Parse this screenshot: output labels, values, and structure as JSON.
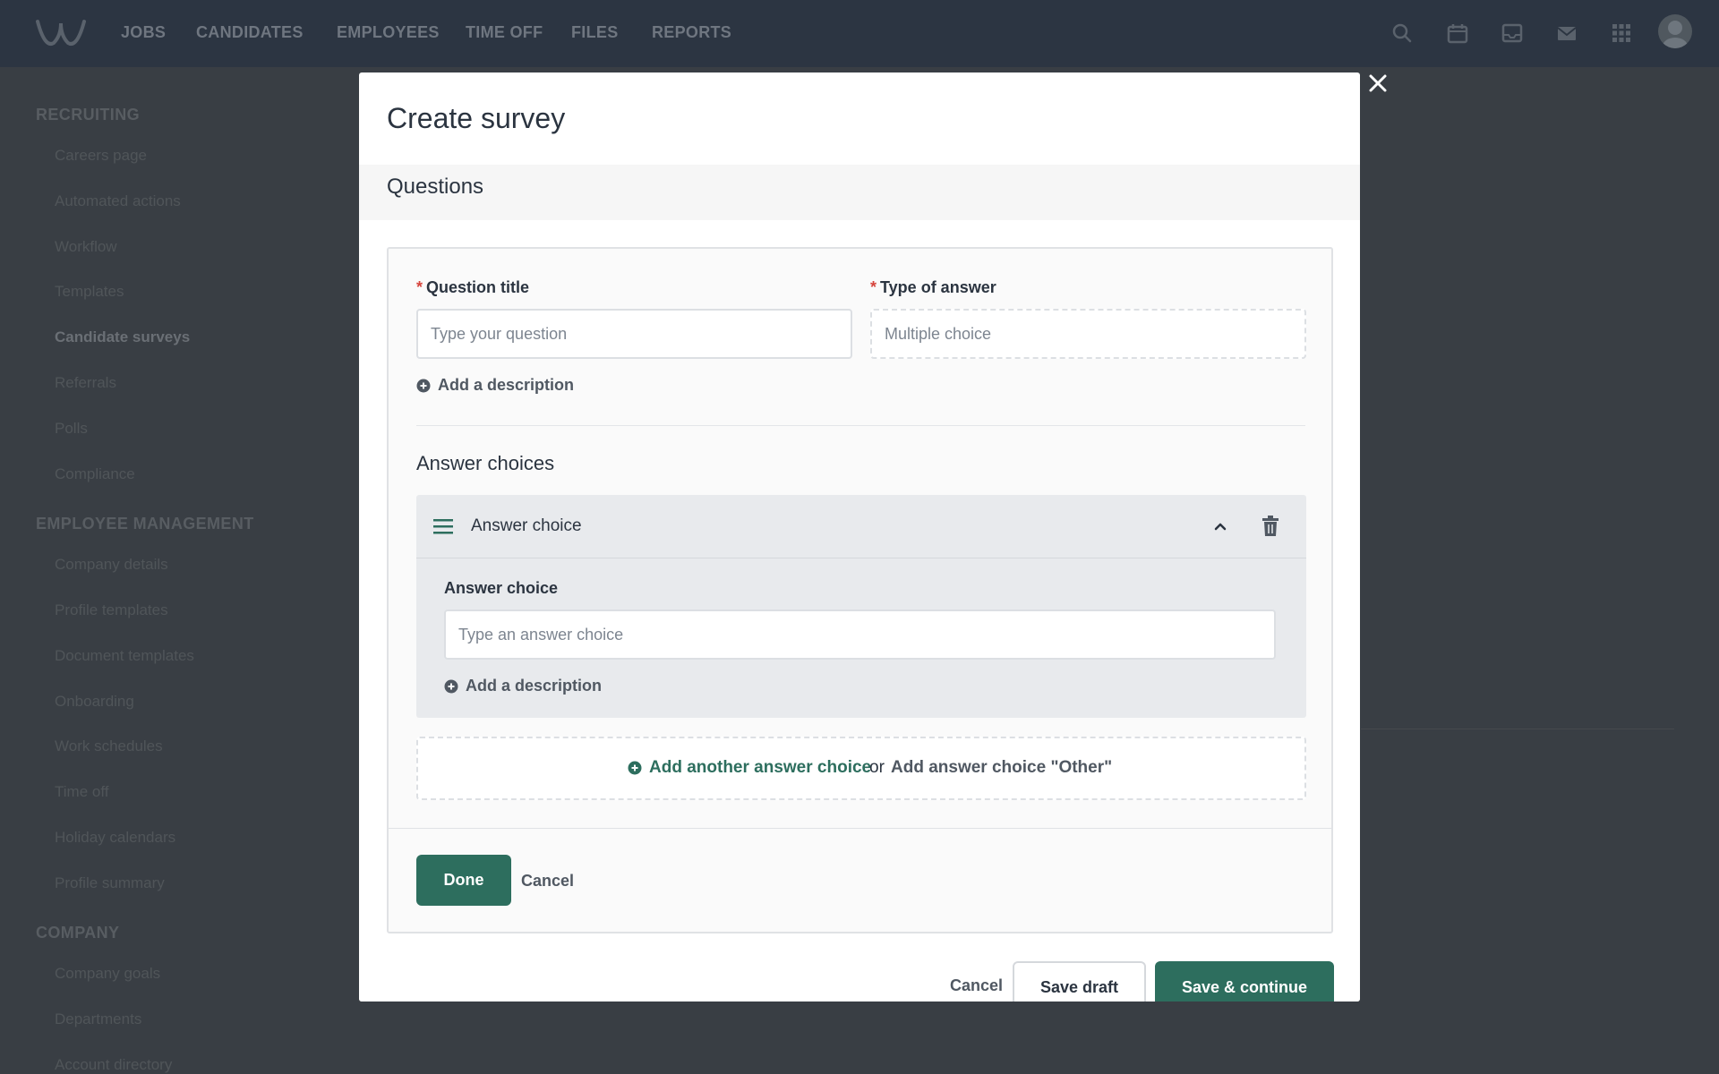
{
  "topnav": {
    "items": [
      "JOBS",
      "CANDIDATES",
      "EMPLOYEES",
      "TIME OFF",
      "FILES",
      "REPORTS"
    ],
    "icons": [
      "search-icon",
      "calendar-icon",
      "inbox-icon",
      "mail-icon",
      "apps-grid-icon"
    ]
  },
  "sidebar": {
    "sections": [
      {
        "heading": "RECRUITING",
        "items": [
          "Careers page",
          "Automated actions",
          "Workflow",
          "Templates",
          "Candidate surveys",
          "Referrals",
          "Polls",
          "Compliance"
        ]
      },
      {
        "heading": "EMPLOYEE MANAGEMENT",
        "items": [
          "Company details",
          "Profile templates",
          "Document templates",
          "Onboarding",
          "Work schedules",
          "Time off",
          "Holiday calendars",
          "Profile summary"
        ]
      },
      {
        "heading": "COMPANY",
        "items": [
          "Company goals",
          "Departments",
          "Account directory"
        ]
      }
    ],
    "active_item": "Candidate surveys"
  },
  "modal": {
    "title": "Create survey",
    "section_title": "Questions",
    "question_title_label": "Question title",
    "question_title_placeholder": "Type your question",
    "type_label": "Type of answer",
    "type_value": "Multiple choice",
    "add_description": "Add a description",
    "answer_choices_heading": "Answer choices",
    "choice_header_label": "Answer choice",
    "choice_field_label": "Answer choice",
    "choice_placeholder": "Type an answer choice",
    "choice_add_description": "Add a description",
    "add_another_choice": "Add another answer choice",
    "or_text": "or",
    "add_other_choice": "Add answer choice \"Other\"",
    "done_button": "Done",
    "cancel_link": "Cancel",
    "footer": {
      "cancel": "Cancel",
      "save_draft": "Save draft",
      "save_continue": "Save & continue"
    }
  },
  "colors": {
    "primary": "#2d6e5e",
    "required": "#d6453d",
    "overlay_bg": "#393e44",
    "nav_bg": "#2c3542"
  }
}
